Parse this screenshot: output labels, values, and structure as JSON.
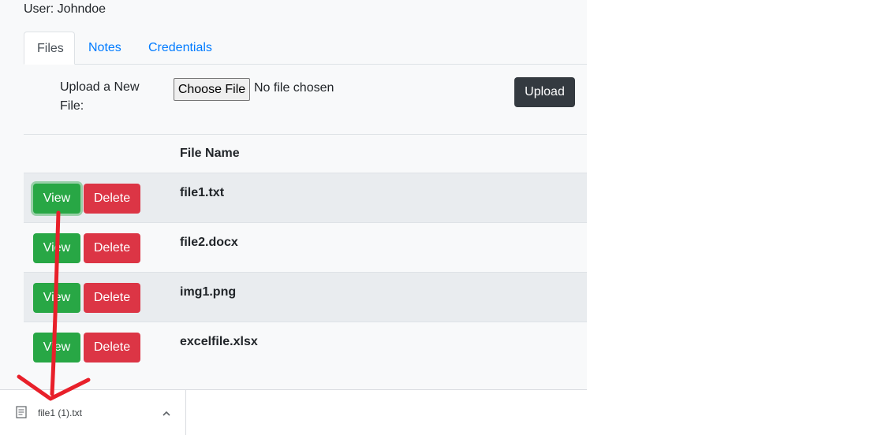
{
  "user": {
    "label": "User: Johndoe"
  },
  "tabs": [
    {
      "label": "Files"
    },
    {
      "label": "Notes"
    },
    {
      "label": "Credentials"
    }
  ],
  "upload": {
    "label": "Upload a New File:",
    "choose_button": "Choose File",
    "no_file_text": "No file chosen",
    "upload_button": "Upload"
  },
  "table": {
    "header_filename": "File Name",
    "view_label": "View",
    "delete_label": "Delete",
    "rows": [
      {
        "filename": "file1.txt"
      },
      {
        "filename": "file2.docx"
      },
      {
        "filename": "img1.png"
      },
      {
        "filename": "excelfile.xlsx"
      }
    ]
  },
  "download_bar": {
    "file_name": "file1 (1).txt",
    "file_icon": "file-icon",
    "chevron_icon": "chevron-up-icon"
  },
  "colors": {
    "view_green": "#28a745",
    "delete_red": "#dc3545",
    "upload_dark": "#343a40",
    "tab_link_blue": "#007bff",
    "annotation_arrow_red": "#e8202a"
  }
}
